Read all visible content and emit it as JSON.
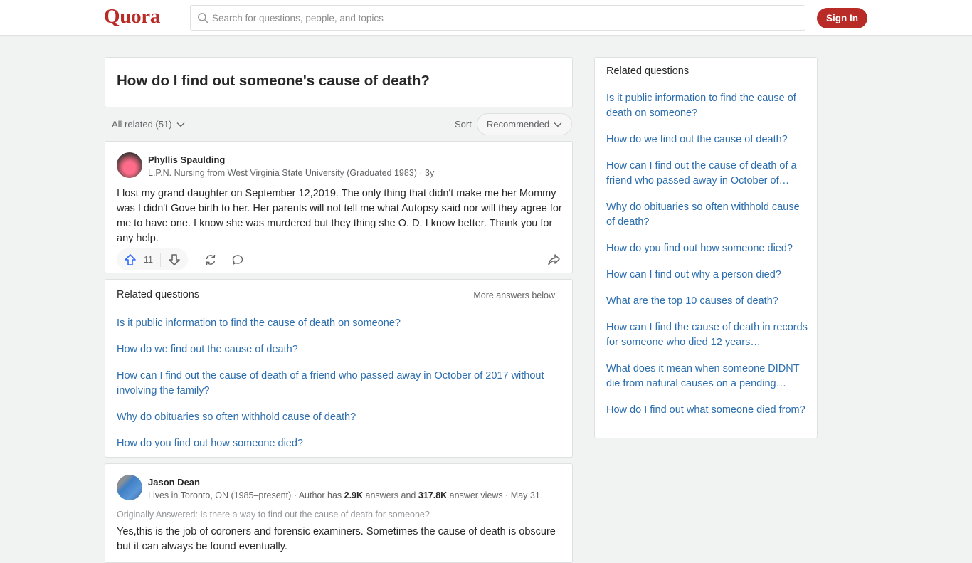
{
  "header": {
    "logo": "Quora",
    "search_placeholder": "Search for questions, people, and topics",
    "signin_label": "Sign In",
    "brand_color": "#b92b27"
  },
  "question": {
    "title": "How do I find out someone's cause of death?"
  },
  "filters": {
    "all_related": "All related (51)",
    "sort_label": "Sort",
    "sort_value": "Recommended"
  },
  "answers": [
    {
      "author": "Phyllis Spaulding",
      "credential": "L.P.N. Nursing from West Virginia State University (Graduated 1983) · 3y",
      "body": "I lost my grand daughter on September 12,2019. The only thing that didn't make me her Mommy was I didn't Gove birth to her. Her parents will not tell me what Autopsy said nor will they agree for me to have one. I know she was murdered but they thing she O. D. I know better. Thank you for any help.",
      "upvotes": "11"
    },
    {
      "author": "Jason Dean",
      "credential_prefix": "Lives in Toronto, ON (1985–present) · Author has ",
      "answers_count": "2.9K",
      "credential_mid": " answers and ",
      "views_count": "317.8K",
      "credential_suffix": " answer views · May 31",
      "originally_answered": "Originally Answered: Is there a way to find out the cause of death for someone?",
      "body": "Yes,this is the job of coroners and forensic examiners. Sometimes the cause of death is obscure but it can always be found eventually."
    }
  ],
  "inline_related": {
    "title": "Related questions",
    "more": "More answers below",
    "items": [
      "Is it public information to find the cause of death on someone?",
      "How do we find out the cause of death?",
      "How can I find out the cause of death of a friend who passed away in October of 2017 without involving the family?",
      "Why do obituaries so often withhold cause of death?",
      "How do you find out how someone died?"
    ]
  },
  "sidebar": {
    "title": "Related questions",
    "items": [
      "Is it public information to find the cause of death on someone?",
      "How do we find out the cause of death?",
      "How can I find out the cause of death of a friend who passed away in October of…",
      "Why do obituaries so often withhold cause of death?",
      "How do you find out how someone died?",
      "How can I find out why a person died?",
      "What are the top 10 causes of death?",
      "How can I find the cause of death in records for someone who died 12 years…",
      "What does it mean when someone DIDNT die from natural causes on a pending…",
      "How do I find out what someone died from?"
    ]
  }
}
